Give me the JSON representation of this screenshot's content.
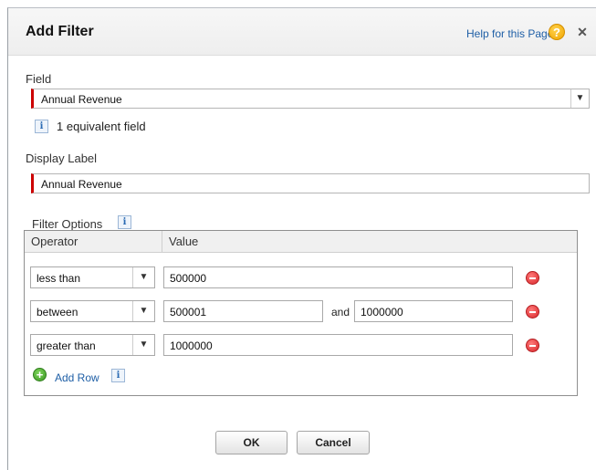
{
  "dialog": {
    "title": "Add Filter",
    "help_link": "Help for this Page",
    "help_icon": "?",
    "close_icon": "✕"
  },
  "field": {
    "label": "Field",
    "value": "Annual Revenue",
    "note": "1 equivalent field",
    "info_icon": "i"
  },
  "display_label": {
    "label": "Display Label",
    "value": "Annual Revenue"
  },
  "filter_options": {
    "label": "Filter Options",
    "info_icon": "i",
    "columns": {
      "operator": "Operator",
      "value": "Value"
    },
    "rows": [
      {
        "operator": "less than",
        "value": "500000"
      },
      {
        "operator": "between",
        "value": "500001",
        "and_label": "and",
        "value2": "1000000"
      },
      {
        "operator": "greater than",
        "value": "1000000"
      }
    ],
    "add_row": "Add Row",
    "add_row_info": "i",
    "arrow": "▼"
  },
  "buttons": {
    "ok": "OK",
    "cancel": "Cancel"
  }
}
